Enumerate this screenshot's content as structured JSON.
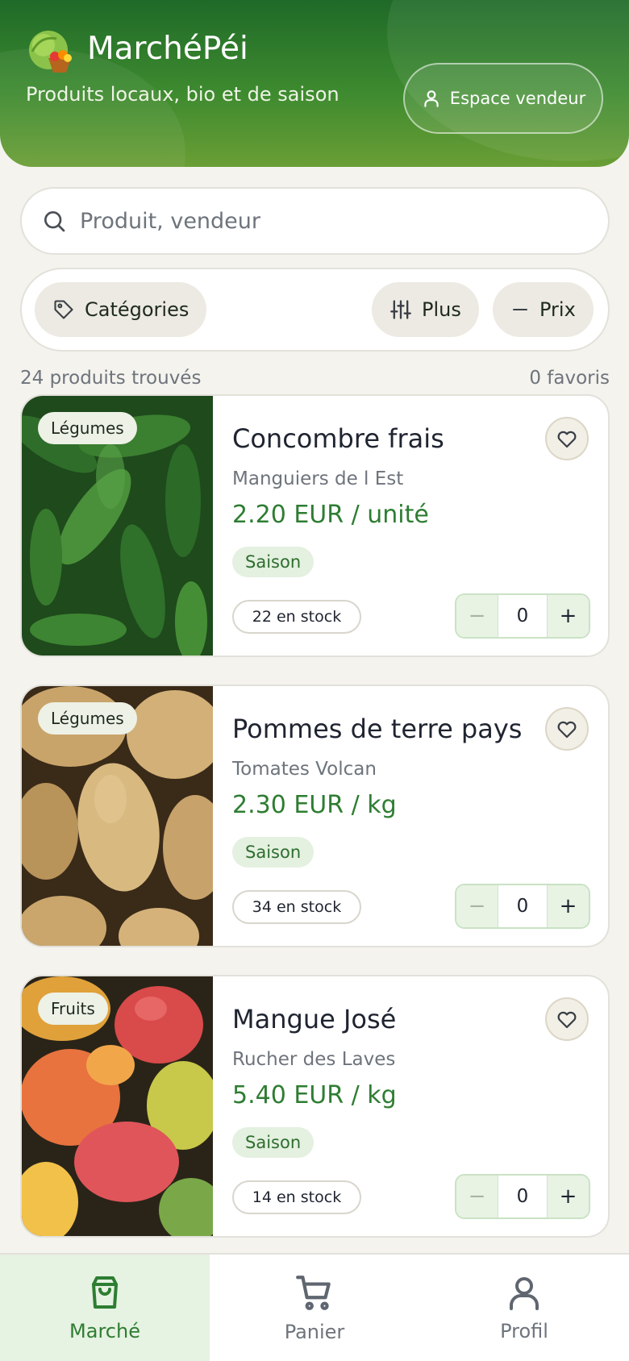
{
  "header": {
    "title": "MarchéPéi",
    "subtitle": "Produits locaux, bio et de saison",
    "vendor_button_label": "Espace vendeur"
  },
  "search": {
    "placeholder": "Produit, vendeur",
    "value": ""
  },
  "filters": {
    "categories_label": "Catégories",
    "more_label": "Plus",
    "price_label": "Prix"
  },
  "results": {
    "count_text": "24 produits trouvés",
    "favorites_text": "0 favoris"
  },
  "products": [
    {
      "category": "Légumes",
      "name": "Concombre frais",
      "vendor": "Manguiers de l Est",
      "price": "2.20 EUR / unité",
      "season_badge": "Saison",
      "stock": "22 en stock",
      "quantity": "0",
      "image": "cucumbers-photo"
    },
    {
      "category": "Légumes",
      "name": "Pommes de terre pays",
      "vendor": "Tomates Volcan",
      "price": "2.30 EUR / kg",
      "season_badge": "Saison",
      "stock": "34 en stock",
      "quantity": "0",
      "image": "potatoes-photo"
    },
    {
      "category": "Fruits",
      "name": "Mangue José",
      "vendor": "Rucher des Laves",
      "price": "5.40 EUR / kg",
      "season_badge": "Saison",
      "stock": "14 en stock",
      "quantity": "0",
      "image": "mangoes-photo"
    }
  ],
  "bottom_nav": {
    "items": [
      {
        "label": "Marché",
        "icon": "shopping-bag-icon",
        "active": true
      },
      {
        "label": "Panier",
        "icon": "cart-icon",
        "active": false
      },
      {
        "label": "Profil",
        "icon": "user-icon",
        "active": false
      }
    ]
  },
  "colors": {
    "brand_green": "#2e7d32",
    "header_dark": "#1f6a28",
    "header_light": "#6a9e35",
    "background": "#f4f3ee"
  }
}
